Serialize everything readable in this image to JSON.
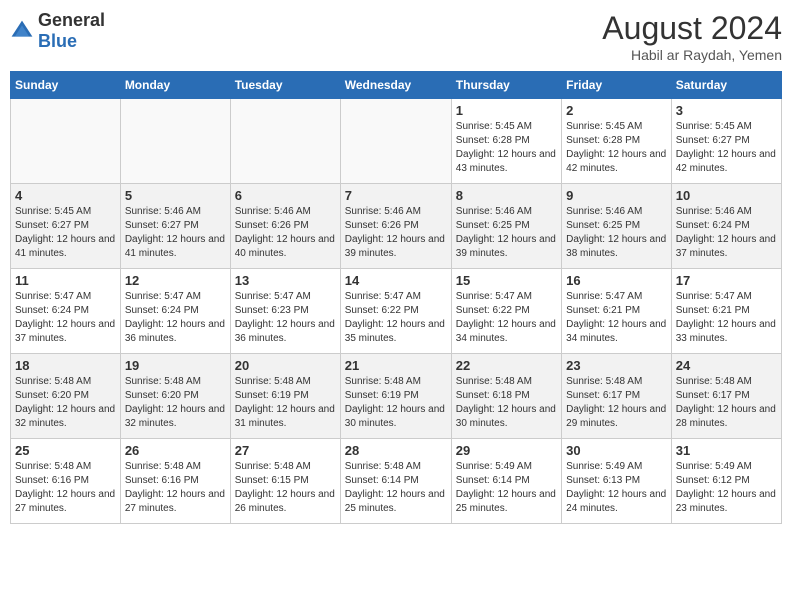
{
  "header": {
    "logo_general": "General",
    "logo_blue": "Blue",
    "month_year": "August 2024",
    "location": "Habil ar Raydah, Yemen"
  },
  "weekdays": [
    "Sunday",
    "Monday",
    "Tuesday",
    "Wednesday",
    "Thursday",
    "Friday",
    "Saturday"
  ],
  "weeks": [
    [
      {
        "day": "",
        "detail": ""
      },
      {
        "day": "",
        "detail": ""
      },
      {
        "day": "",
        "detail": ""
      },
      {
        "day": "",
        "detail": ""
      },
      {
        "day": "1",
        "detail": "Sunrise: 5:45 AM\nSunset: 6:28 PM\nDaylight: 12 hours and 43 minutes."
      },
      {
        "day": "2",
        "detail": "Sunrise: 5:45 AM\nSunset: 6:28 PM\nDaylight: 12 hours and 42 minutes."
      },
      {
        "day": "3",
        "detail": "Sunrise: 5:45 AM\nSunset: 6:27 PM\nDaylight: 12 hours and 42 minutes."
      }
    ],
    [
      {
        "day": "4",
        "detail": "Sunrise: 5:45 AM\nSunset: 6:27 PM\nDaylight: 12 hours and 41 minutes."
      },
      {
        "day": "5",
        "detail": "Sunrise: 5:46 AM\nSunset: 6:27 PM\nDaylight: 12 hours and 41 minutes."
      },
      {
        "day": "6",
        "detail": "Sunrise: 5:46 AM\nSunset: 6:26 PM\nDaylight: 12 hours and 40 minutes."
      },
      {
        "day": "7",
        "detail": "Sunrise: 5:46 AM\nSunset: 6:26 PM\nDaylight: 12 hours and 39 minutes."
      },
      {
        "day": "8",
        "detail": "Sunrise: 5:46 AM\nSunset: 6:25 PM\nDaylight: 12 hours and 39 minutes."
      },
      {
        "day": "9",
        "detail": "Sunrise: 5:46 AM\nSunset: 6:25 PM\nDaylight: 12 hours and 38 minutes."
      },
      {
        "day": "10",
        "detail": "Sunrise: 5:46 AM\nSunset: 6:24 PM\nDaylight: 12 hours and 37 minutes."
      }
    ],
    [
      {
        "day": "11",
        "detail": "Sunrise: 5:47 AM\nSunset: 6:24 PM\nDaylight: 12 hours and 37 minutes."
      },
      {
        "day": "12",
        "detail": "Sunrise: 5:47 AM\nSunset: 6:24 PM\nDaylight: 12 hours and 36 minutes."
      },
      {
        "day": "13",
        "detail": "Sunrise: 5:47 AM\nSunset: 6:23 PM\nDaylight: 12 hours and 36 minutes."
      },
      {
        "day": "14",
        "detail": "Sunrise: 5:47 AM\nSunset: 6:22 PM\nDaylight: 12 hours and 35 minutes."
      },
      {
        "day": "15",
        "detail": "Sunrise: 5:47 AM\nSunset: 6:22 PM\nDaylight: 12 hours and 34 minutes."
      },
      {
        "day": "16",
        "detail": "Sunrise: 5:47 AM\nSunset: 6:21 PM\nDaylight: 12 hours and 34 minutes."
      },
      {
        "day": "17",
        "detail": "Sunrise: 5:47 AM\nSunset: 6:21 PM\nDaylight: 12 hours and 33 minutes."
      }
    ],
    [
      {
        "day": "18",
        "detail": "Sunrise: 5:48 AM\nSunset: 6:20 PM\nDaylight: 12 hours and 32 minutes."
      },
      {
        "day": "19",
        "detail": "Sunrise: 5:48 AM\nSunset: 6:20 PM\nDaylight: 12 hours and 32 minutes."
      },
      {
        "day": "20",
        "detail": "Sunrise: 5:48 AM\nSunset: 6:19 PM\nDaylight: 12 hours and 31 minutes."
      },
      {
        "day": "21",
        "detail": "Sunrise: 5:48 AM\nSunset: 6:19 PM\nDaylight: 12 hours and 30 minutes."
      },
      {
        "day": "22",
        "detail": "Sunrise: 5:48 AM\nSunset: 6:18 PM\nDaylight: 12 hours and 30 minutes."
      },
      {
        "day": "23",
        "detail": "Sunrise: 5:48 AM\nSunset: 6:17 PM\nDaylight: 12 hours and 29 minutes."
      },
      {
        "day": "24",
        "detail": "Sunrise: 5:48 AM\nSunset: 6:17 PM\nDaylight: 12 hours and 28 minutes."
      }
    ],
    [
      {
        "day": "25",
        "detail": "Sunrise: 5:48 AM\nSunset: 6:16 PM\nDaylight: 12 hours and 27 minutes."
      },
      {
        "day": "26",
        "detail": "Sunrise: 5:48 AM\nSunset: 6:16 PM\nDaylight: 12 hours and 27 minutes."
      },
      {
        "day": "27",
        "detail": "Sunrise: 5:48 AM\nSunset: 6:15 PM\nDaylight: 12 hours and 26 minutes."
      },
      {
        "day": "28",
        "detail": "Sunrise: 5:48 AM\nSunset: 6:14 PM\nDaylight: 12 hours and 25 minutes."
      },
      {
        "day": "29",
        "detail": "Sunrise: 5:49 AM\nSunset: 6:14 PM\nDaylight: 12 hours and 25 minutes."
      },
      {
        "day": "30",
        "detail": "Sunrise: 5:49 AM\nSunset: 6:13 PM\nDaylight: 12 hours and 24 minutes."
      },
      {
        "day": "31",
        "detail": "Sunrise: 5:49 AM\nSunset: 6:12 PM\nDaylight: 12 hours and 23 minutes."
      }
    ]
  ]
}
